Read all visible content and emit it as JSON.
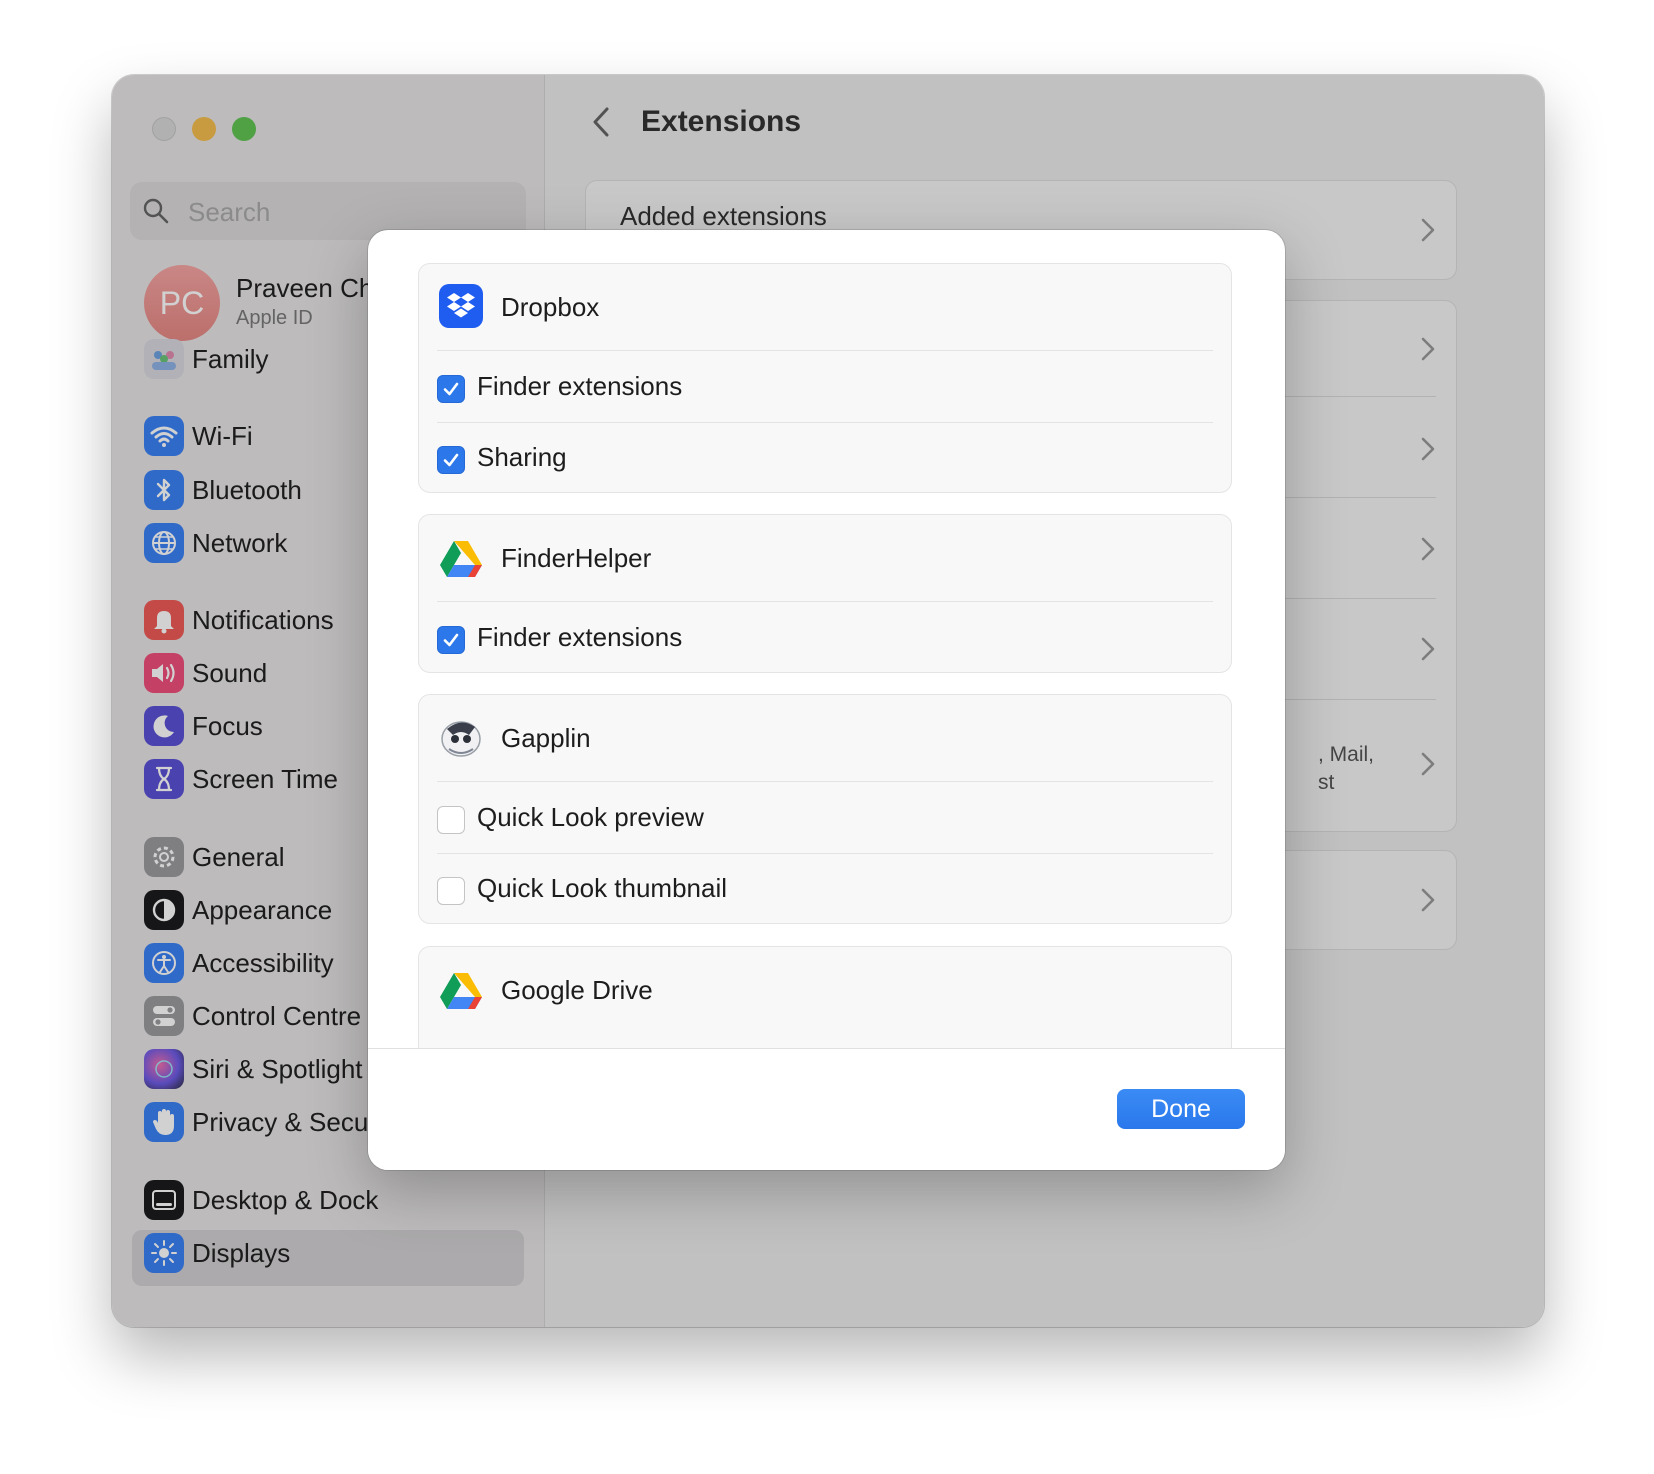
{
  "window": {
    "traffic_lights": [
      "close",
      "minimize",
      "maximize"
    ]
  },
  "sidebar": {
    "search_placeholder": "Search",
    "account": {
      "initials": "PC",
      "name": "Praveen Ch",
      "subtitle": "Apple ID"
    },
    "items": [
      {
        "label": "Family",
        "icon": "family-icon"
      },
      {
        "label": "Wi-Fi",
        "icon": "wifi-icon"
      },
      {
        "label": "Bluetooth",
        "icon": "bluetooth-icon"
      },
      {
        "label": "Network",
        "icon": "globe-icon"
      },
      {
        "label": "Notifications",
        "icon": "bell-icon"
      },
      {
        "label": "Sound",
        "icon": "speaker-icon"
      },
      {
        "label": "Focus",
        "icon": "moon-icon"
      },
      {
        "label": "Screen Time",
        "icon": "hourglass-icon"
      },
      {
        "label": "General",
        "icon": "gear-icon"
      },
      {
        "label": "Appearance",
        "icon": "appearance-icon"
      },
      {
        "label": "Accessibility",
        "icon": "accessibility-icon"
      },
      {
        "label": "Control Centre",
        "icon": "toggles-icon"
      },
      {
        "label": "Siri & Spotlight",
        "icon": "siri-icon"
      },
      {
        "label": "Privacy & Security",
        "icon": "hand-icon",
        "selected": true
      },
      {
        "label": "Desktop & Dock",
        "icon": "dock-icon"
      },
      {
        "label": "Displays",
        "icon": "sun-icon"
      }
    ]
  },
  "main": {
    "title": "Extensions",
    "first_row": "Added extensions",
    "partial_row": {
      "line1": ", Mail,",
      "line2": "st"
    },
    "help": "?"
  },
  "sheet": {
    "groups": [
      {
        "app": "Dropbox",
        "icon": "dropbox-icon",
        "options": [
          {
            "label": "Finder extensions",
            "checked": true
          },
          {
            "label": "Sharing",
            "checked": true
          }
        ]
      },
      {
        "app": "FinderHelper",
        "icon": "google-drive-icon",
        "options": [
          {
            "label": "Finder extensions",
            "checked": true
          }
        ]
      },
      {
        "app": "Gapplin",
        "icon": "gapplin-icon",
        "options": [
          {
            "label": "Quick Look preview",
            "checked": false
          },
          {
            "label": "Quick Look thumbnail",
            "checked": false
          }
        ]
      },
      {
        "app": "Google Drive",
        "icon": "google-drive-icon",
        "options": []
      }
    ],
    "done_label": "Done"
  },
  "colors": {
    "accent": "#2c78ea",
    "traffic_close": "#d8d8d8",
    "traffic_min": "#f6be4f",
    "traffic_max": "#61c554"
  }
}
